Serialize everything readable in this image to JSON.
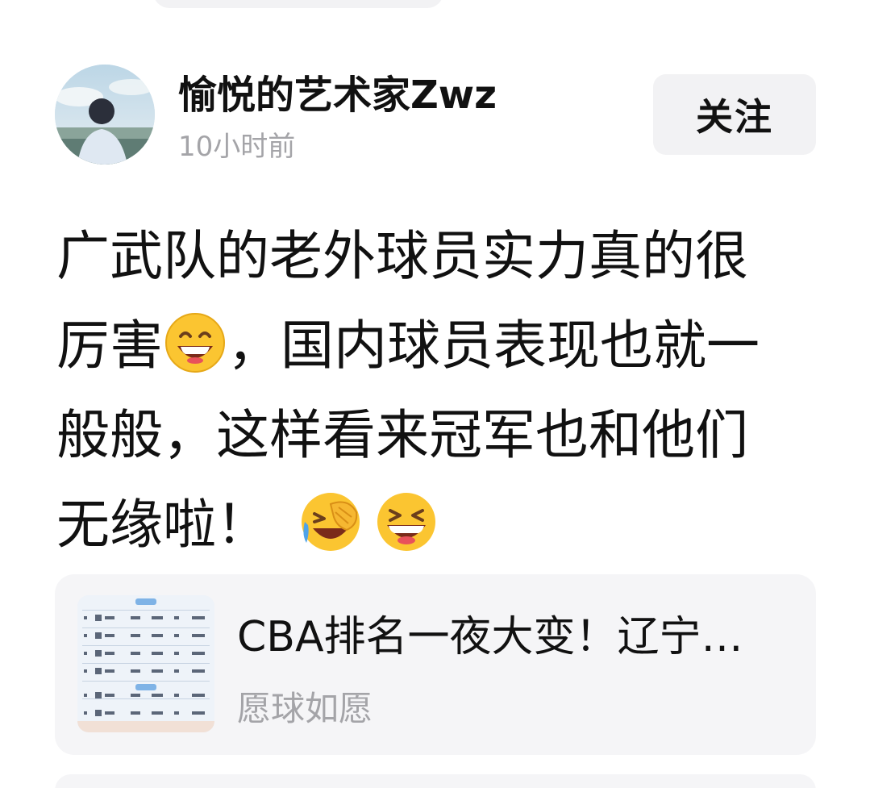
{
  "post": {
    "author": "愉悦的艺术家Zwz",
    "time": "10小时前",
    "follow_label": "关注",
    "text_lines": [
      "广武队的老外球员实力真的很",
      "厉害",
      "，国内球员表现也就一",
      "般般，这样看来冠军也和他们",
      "无缘啦！"
    ],
    "emojis": [
      "grinning-face-icon",
      "face-palm-laughing-icon",
      "laughing-face-icon"
    ]
  },
  "link_card": {
    "title": "CBA排名一夜大变！辽宁…",
    "source": "愿球如愿",
    "thumbnail_icon": "standings-table-thumbnail"
  }
}
